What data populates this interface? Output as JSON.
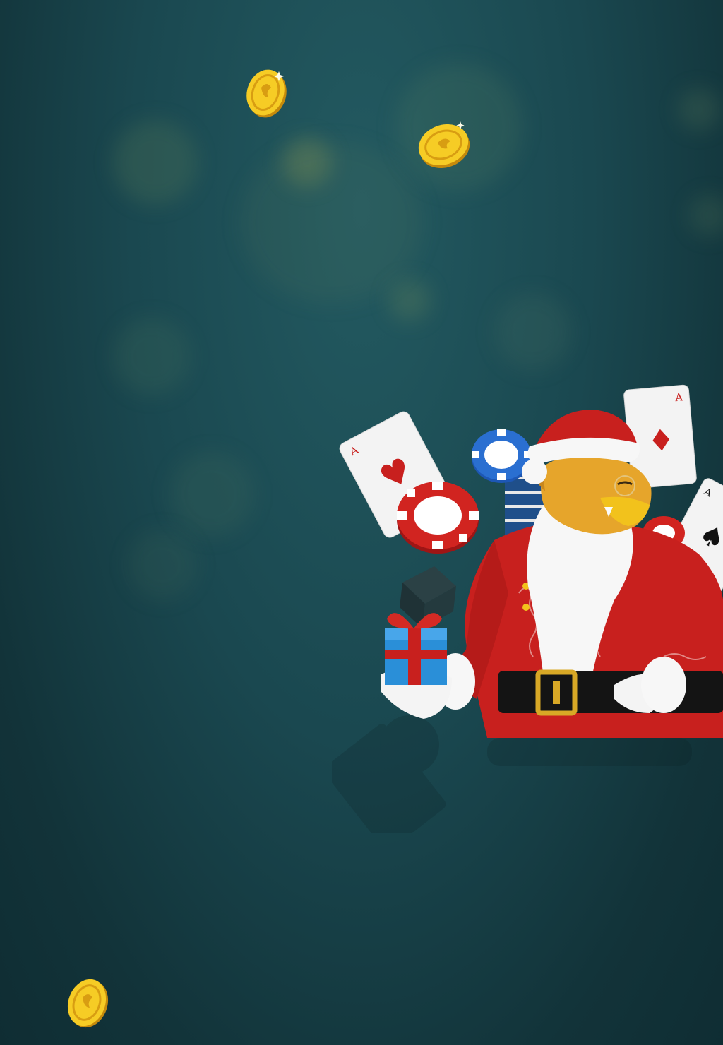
{
  "scene": {
    "background_colors": [
      "#235a61",
      "#1a4850",
      "#123339",
      "#0f2d33"
    ],
    "accent_gold": "#f2c21c",
    "accent_red": "#c8201e",
    "accent_blue": "#2a6fd1"
  },
  "hero": {
    "icon": "dragon-santa-illustration",
    "cards": [
      {
        "rank": "A",
        "suit": "♥"
      },
      {
        "rank": "A",
        "suit": "♦"
      },
      {
        "rank": "A",
        "suit": "♠"
      }
    ]
  },
  "coins": [
    {
      "icon": "gold-coin-icon"
    },
    {
      "icon": "gold-coin-icon"
    },
    {
      "icon": "gold-coin-icon"
    }
  ]
}
